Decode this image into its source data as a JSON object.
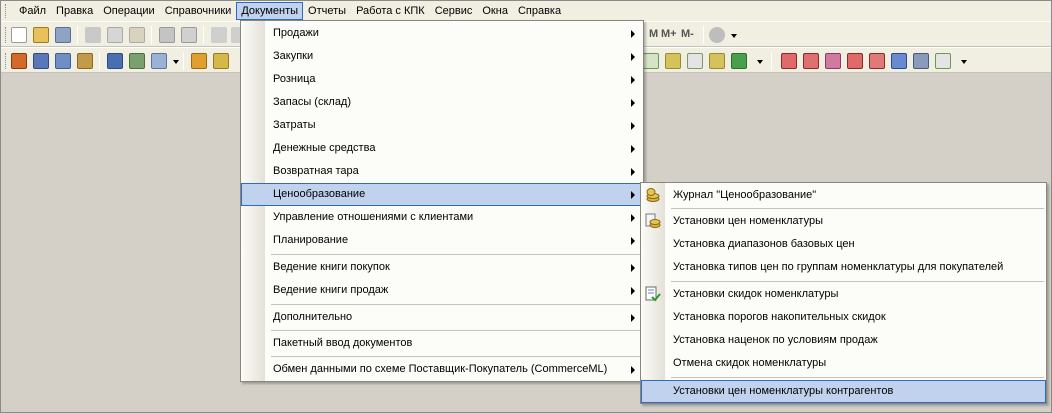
{
  "menubar": {
    "items": [
      {
        "label": "Файл"
      },
      {
        "label": "Правка"
      },
      {
        "label": "Операции"
      },
      {
        "label": "Справочники"
      },
      {
        "label": "Документы"
      },
      {
        "label": "Отчеты"
      },
      {
        "label": "Работа с КПК"
      },
      {
        "label": "Сервис"
      },
      {
        "label": "Окна"
      },
      {
        "label": "Справка"
      }
    ]
  },
  "toolbar": {
    "memory_m": "M",
    "memory_mplus": "M+",
    "memory_mminus": "M-"
  },
  "documents_menu": {
    "items": [
      {
        "label": "Продажи"
      },
      {
        "label": "Закупки"
      },
      {
        "label": "Розница"
      },
      {
        "label": "Запасы (склад)"
      },
      {
        "label": "Затраты"
      },
      {
        "label": "Денежные средства"
      },
      {
        "label": "Возвратная тара"
      },
      {
        "label": "Ценообразование"
      },
      {
        "label": "Управление отношениями с клиентами"
      },
      {
        "label": "Планирование"
      },
      {
        "label": "Ведение книги покупок"
      },
      {
        "label": "Ведение книги продаж"
      },
      {
        "label": "Дополнительно"
      },
      {
        "label": "Пакетный ввод документов"
      },
      {
        "label": "Обмен данными по схеме Поставщик-Покупатель (CommerceML)"
      }
    ]
  },
  "pricing_submenu": {
    "items": [
      {
        "label": "Журнал \"Ценообразование\""
      },
      {
        "label": "Установки цен номенклатуры"
      },
      {
        "label": "Установка диапазонов базовых цен"
      },
      {
        "label": "Установка типов цен по группам номенклатуры для покупателей"
      },
      {
        "label": "Установки скидок номенклатуры"
      },
      {
        "label": "Установка порогов накопительных скидок"
      },
      {
        "label": "Установка наценок по условиям продаж"
      },
      {
        "label": "Отмена скидок номенклатуры"
      },
      {
        "label": "Установки цен номенклатуры контрагентов"
      }
    ]
  },
  "colors": {
    "menu_highlight": "#c1d2ee",
    "menu_highlight_border": "#316ac5",
    "workspace": "#d4d0c8"
  }
}
